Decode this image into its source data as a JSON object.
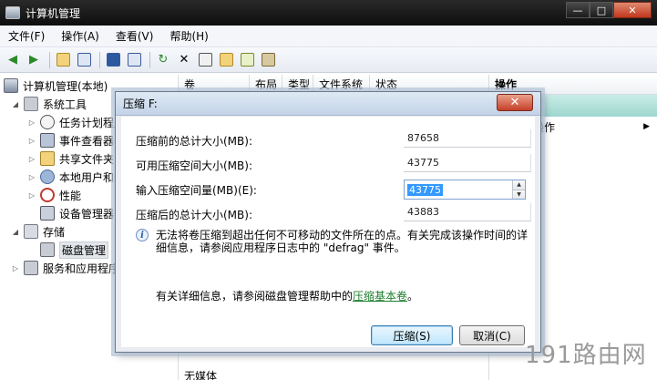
{
  "window": {
    "title": "计算机管理",
    "min": "—",
    "max": "□",
    "close": "✕"
  },
  "menu": [
    "文件(F)",
    "操作(A)",
    "查看(V)",
    "帮助(H)"
  ],
  "tree": {
    "root": "计算机管理(本地)",
    "system_tools": "系统工具",
    "task_scheduler": "任务计划程序",
    "event_viewer": "事件查看器",
    "shared_folders": "共享文件夹",
    "local_users": "本地用户和组",
    "performance": "性能",
    "device_manager": "设备管理器",
    "storage": "存储",
    "disk_management": "磁盘管理",
    "services_apps": "服务和应用程序"
  },
  "columns": [
    "卷",
    "布局",
    "类型",
    "文件系统",
    "状态"
  ],
  "list_footer": "无媒体",
  "actions": {
    "header": "操作",
    "more": "操作",
    "more_arrow": "▶"
  },
  "dialog": {
    "title": "压缩 F:",
    "close": "✕",
    "fields": [
      {
        "label": "压缩前的总计大小(MB):",
        "value": "87658"
      },
      {
        "label": "可用压缩空间大小(MB):",
        "value": "43775"
      },
      {
        "label": "输入压缩空间量(MB)(E):",
        "value": "43775"
      },
      {
        "label": "压缩后的总计大小(MB):",
        "value": "43883"
      }
    ],
    "info": "无法将卷压缩到超出任何不可移动的文件所在的点。有关完成该操作时间的详细信息，请参阅应用程序日志中的 \"defrag\" 事件。",
    "help_prefix": "有关详细信息，请参阅磁盘管理帮助中的",
    "help_link": "压缩基本卷",
    "help_suffix": "。",
    "ok": "压缩(S)",
    "cancel": "取消(C)"
  },
  "watermark": "191路由网"
}
